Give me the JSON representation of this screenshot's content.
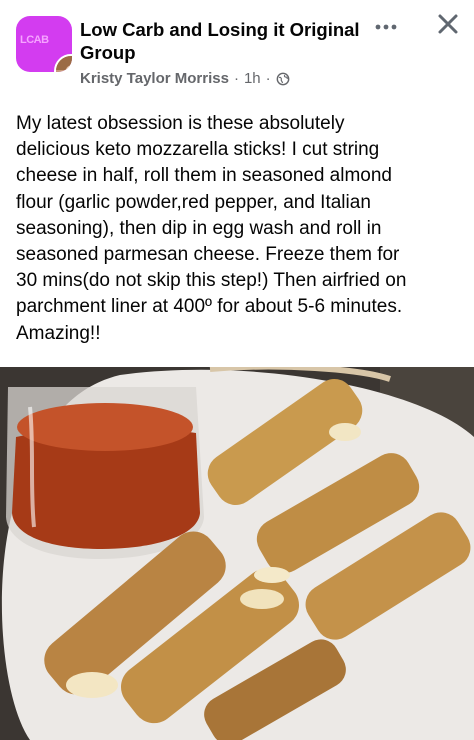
{
  "post": {
    "group_name": "Low Carb and Losing it Original Group",
    "avatar_text": "LCAB",
    "author": "Kristy Taylor Morriss",
    "separator": "·",
    "time": "1h",
    "audience_icon": "globe-icon",
    "more_icon": "more-dots-icon",
    "close_icon": "close-icon",
    "text": "My latest obsession is these absolutely\ndelicious keto mozzarella sticks! I cut string\ncheese in half, roll them in seasoned almond\nflour (garlic powder,red pepper,  and Italian\nseasoning), then dip in egg wash and roll in\nseasoned parmesan cheese.  Freeze them for\n30 mins(do not skip this step!) Then airfried on\nparchment liner at 400º for about 5-6 minutes.\nAmazing!!"
  },
  "colors": {
    "avatar_bg": "#d33cf0",
    "secondary_text": "#65676b",
    "primary_text": "#050505"
  }
}
